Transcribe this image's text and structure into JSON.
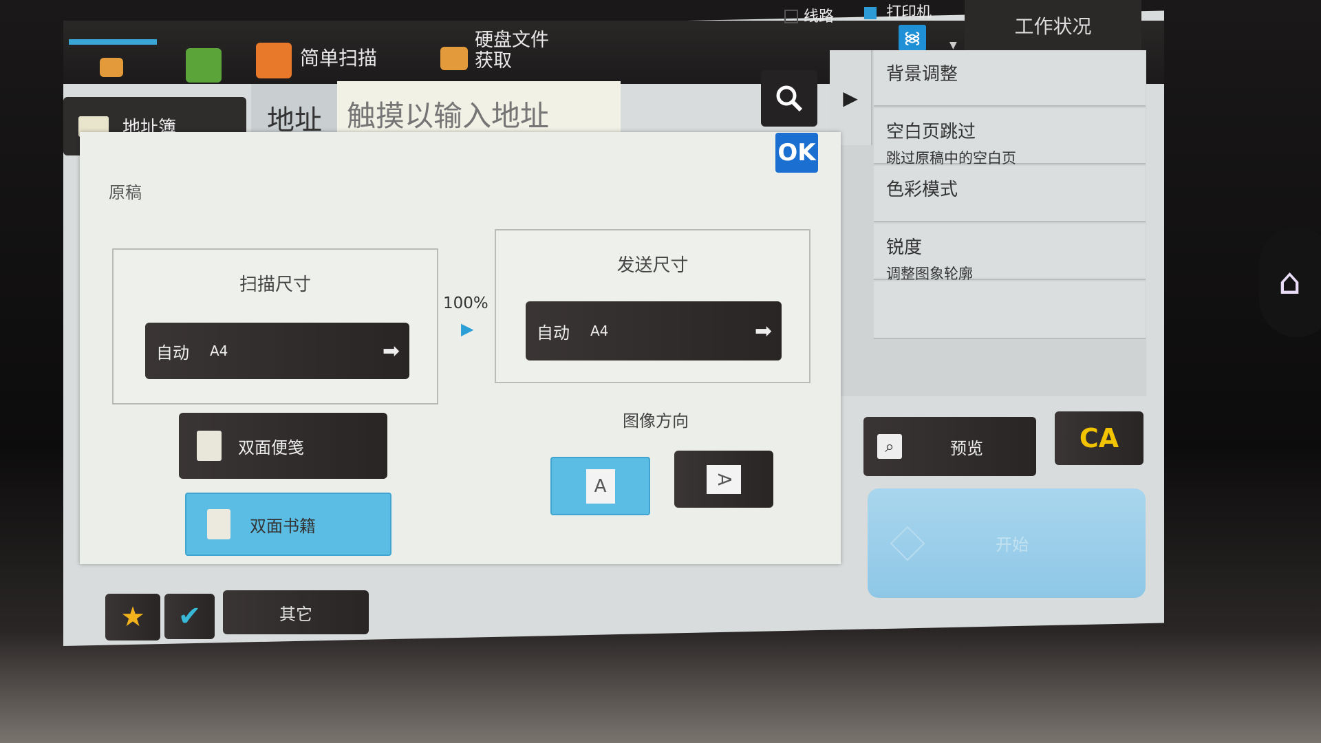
{
  "status": {
    "line_label": "线路",
    "printer_label": "打印机",
    "job_status_tab": "工作状况"
  },
  "toolbar": {
    "simple_scan": "简单扫描",
    "hdd_retrieve": "硬盘文件获取"
  },
  "address": {
    "book_label": "地址簿",
    "label": "地址",
    "placeholder": "触摸以输入地址"
  },
  "dialog": {
    "ok": "OK",
    "section": "原稿",
    "scan_size": {
      "title": "扫描尺寸",
      "mode": "自动",
      "size": "A4"
    },
    "ratio": "100%",
    "send_size": {
      "title": "发送尺寸",
      "mode": "自动",
      "size": "A4"
    },
    "duplex_tablet": "双面便笺",
    "duplex_book": "双面书籍",
    "orientation": {
      "title": "图像方向",
      "options": [
        "A",
        "A"
      ],
      "selected": 0
    }
  },
  "right_menu": [
    {
      "title": "背景调整",
      "sub": ""
    },
    {
      "title": "空白页跳过",
      "sub": "跳过原稿中的空白页"
    },
    {
      "title": "色彩模式",
      "sub": ""
    },
    {
      "title": "锐度",
      "sub": "调整图象轮廓"
    },
    {
      "title": "",
      "sub": ""
    }
  ],
  "actions": {
    "preview": "预览",
    "clear_all": "CA",
    "start": "开始"
  },
  "bottom": {
    "others": "其它"
  },
  "colors": {
    "accent_blue": "#5bbde3",
    "ok_blue": "#1b6fd0",
    "ca_yellow": "#f2c300"
  }
}
